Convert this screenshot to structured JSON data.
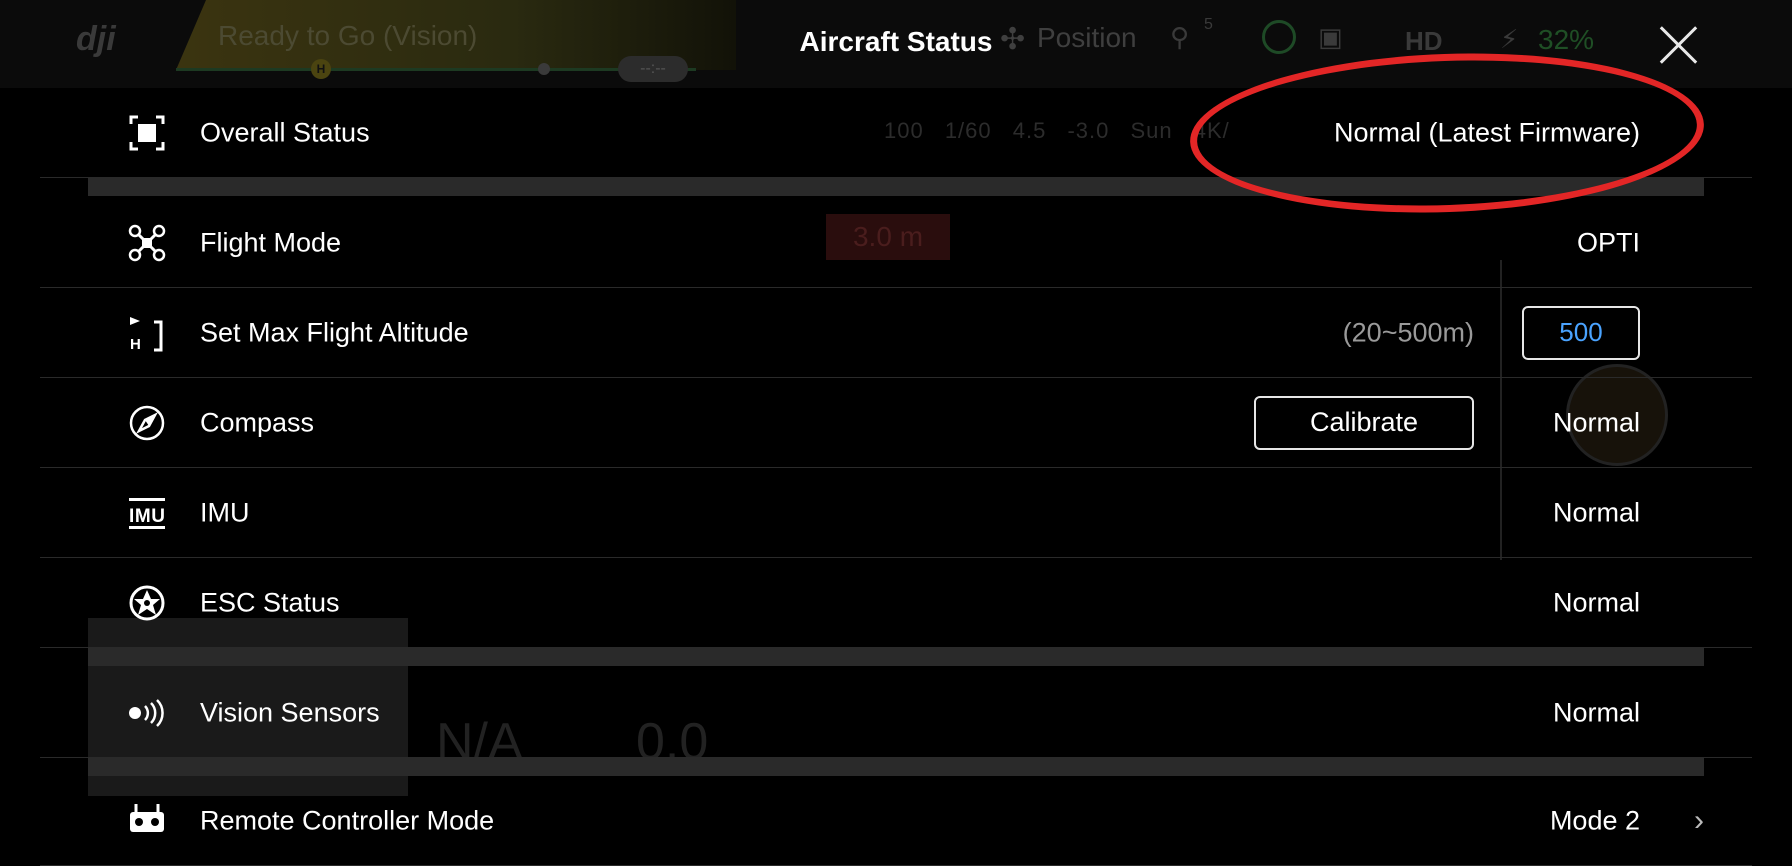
{
  "background": {
    "logo": "dji",
    "flight_state": "Ready to Go (Vision)",
    "home_marker": "H",
    "distance_pill": "--:--",
    "gps_mode": "Position",
    "satellites": "5",
    "hd_label": "HD",
    "battery": "32%",
    "camera_row": "100 1/60 4.5 -3.0 Sun 4K/",
    "altitude_warning": "3.0 m",
    "telemetry_d": "N/A",
    "telemetry_h": "0.0"
  },
  "modal": {
    "title": "Aircraft Status",
    "close_label": "",
    "rows": [
      {
        "id": "overall",
        "label": "Overall Status",
        "value": "Normal (Latest Firmware)"
      },
      {
        "id": "flight-mode",
        "label": "Flight Mode",
        "value": "OPTI"
      },
      {
        "id": "max-alt",
        "label": "Set Max Flight Altitude",
        "range": "(20~500m)",
        "input_value": "500"
      },
      {
        "id": "compass",
        "label": "Compass",
        "button": "Calibrate",
        "value": "Normal"
      },
      {
        "id": "imu",
        "label": "IMU",
        "value": "Normal"
      },
      {
        "id": "esc",
        "label": "ESC Status",
        "value": "Normal"
      },
      {
        "id": "vision",
        "label": "Vision Sensors",
        "value": "Normal"
      },
      {
        "id": "rc-mode",
        "label": "Remote Controller Mode",
        "value": "Mode 2"
      }
    ]
  },
  "colors": {
    "accent_blue": "#4aa3ff",
    "annotation_red": "#e32626",
    "separator": "#2a2a2a"
  }
}
